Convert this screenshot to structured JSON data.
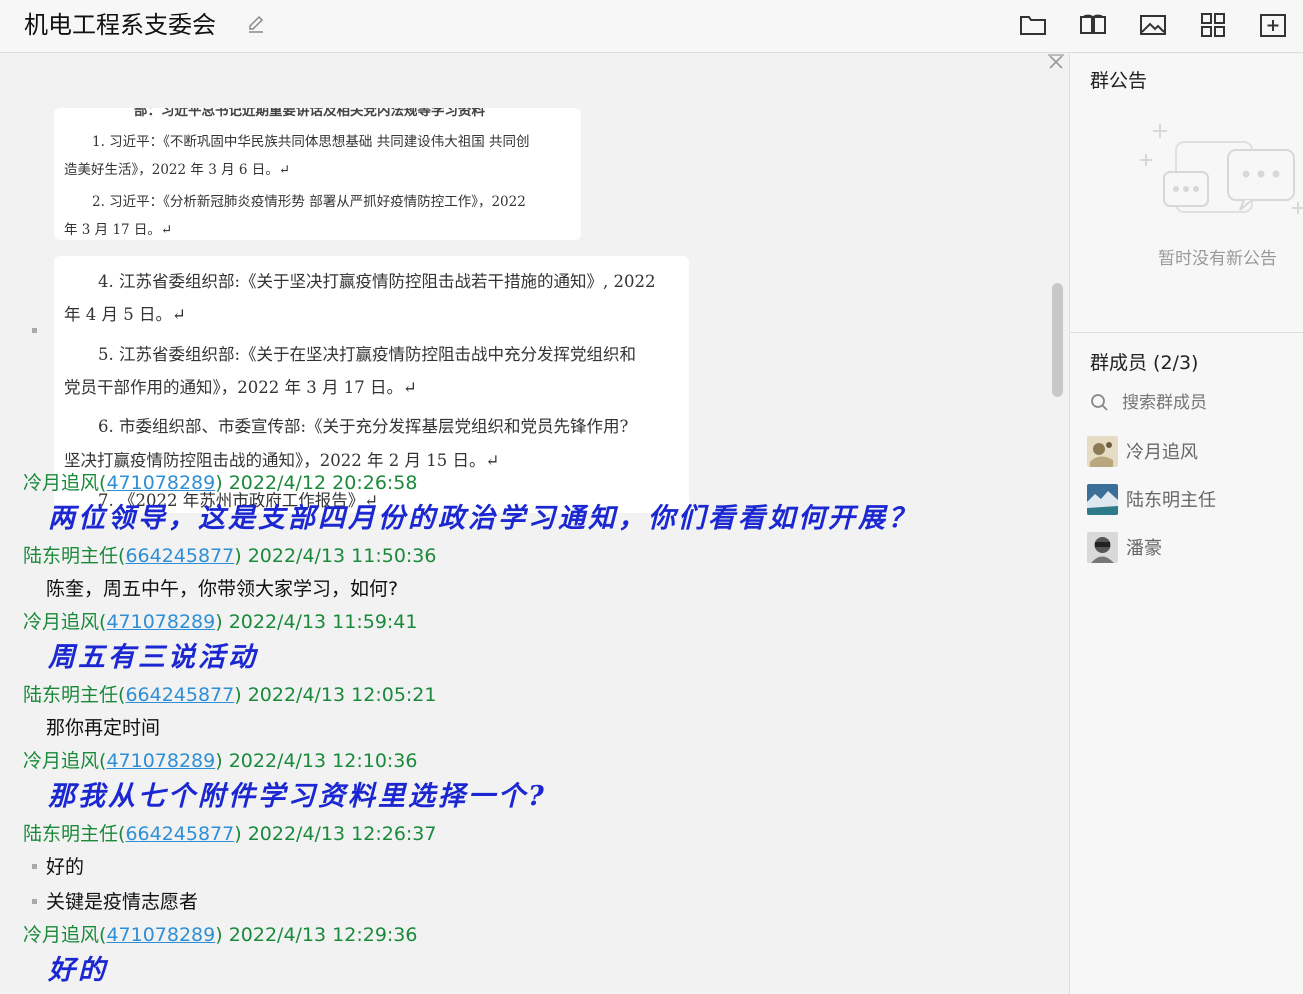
{
  "header": {
    "title": "机电工程系支委会",
    "icons": [
      "edit-icon",
      "folder-icon",
      "book-icon",
      "image-icon",
      "apps-icon",
      "add-window-icon"
    ]
  },
  "attachment_card_1": {
    "cut_line": "部：习近平总书记近期重要讲话及相关党内法规等学习资料",
    "lines": [
      "1. 习近平：《不断巩固中华民族共同体思想基础  共同建设伟大祖国  共同创",
      "造美好生活》，2022 年 3 月 6 日。↵",
      "2. 习近平：《分析新冠肺炎疫情形势  部署从严抓好疫情防控工作》，2022",
      "年 3 月 17 日。↵"
    ]
  },
  "attachment_card_2": {
    "lines": [
      "4. 江苏省委组织部:《关于坚决打赢疫情防控阻击战若干措施的通知》, 2022",
      "年 4 月 5 日。↵",
      "5. 江苏省委组织部:《关于在坚决打赢疫情防控阻击战中充分发挥党组织和",
      "党员干部作用的通知》，2022 年 3 月 17 日。↵",
      "6. 市委组织部、市委宣传部:《关于充分发挥基层党组织和党员先锋作用?",
      "坚决打赢疫情防控阻击战的通知》，2022 年 2 月 15 日。↵",
      "7. 《2022 年苏州市政府工作报告》↵"
    ]
  },
  "messages": [
    {
      "sender": "冷月追风",
      "qq": "471078289",
      "time": "2022/4/12 20:26:58",
      "text": "两位领导，这是支部四月份的政治学习通知，你们看看如何开展？"
    },
    {
      "sender": "陆东明主任",
      "qq": "664245877",
      "time": "2022/4/13 11:50:36",
      "text": "陈奎，周五中午，你带领大家学习，如何?"
    },
    {
      "sender": "冷月追风",
      "qq": "471078289",
      "time": "2022/4/13 11:59:41",
      "text": "周五有三说活动"
    },
    {
      "sender": "陆东明主任",
      "qq": "664245877",
      "time": "2022/4/13 12:05:21",
      "text": "那你再定时间"
    },
    {
      "sender": "冷月追风",
      "qq": "471078289",
      "time": "2022/4/13 12:10:36",
      "text": "那我从七个附件学习资料里选择一个?"
    },
    {
      "sender": "陆东明主任",
      "qq": "664245877",
      "time": "2022/4/13 12:26:37",
      "text": "好的",
      "text2": "关键是疫情志愿者"
    },
    {
      "sender": "冷月追风",
      "qq": "471078289",
      "time": "2022/4/13 12:29:36",
      "text": "好的"
    }
  ],
  "panel": {
    "announcement_title": "群公告",
    "announcement_empty": "暂时没有新公告",
    "members_title": "群成员 (2/3)",
    "search_placeholder": "搜索群成员",
    "members": [
      {
        "name": "冷月追风"
      },
      {
        "name": "陆东明主任"
      },
      {
        "name": "潘豪"
      }
    ]
  },
  "colors": {
    "sender": "#1a8a3a",
    "qq_link": "#2e8fd6",
    "big_text": "#1b27d0"
  }
}
